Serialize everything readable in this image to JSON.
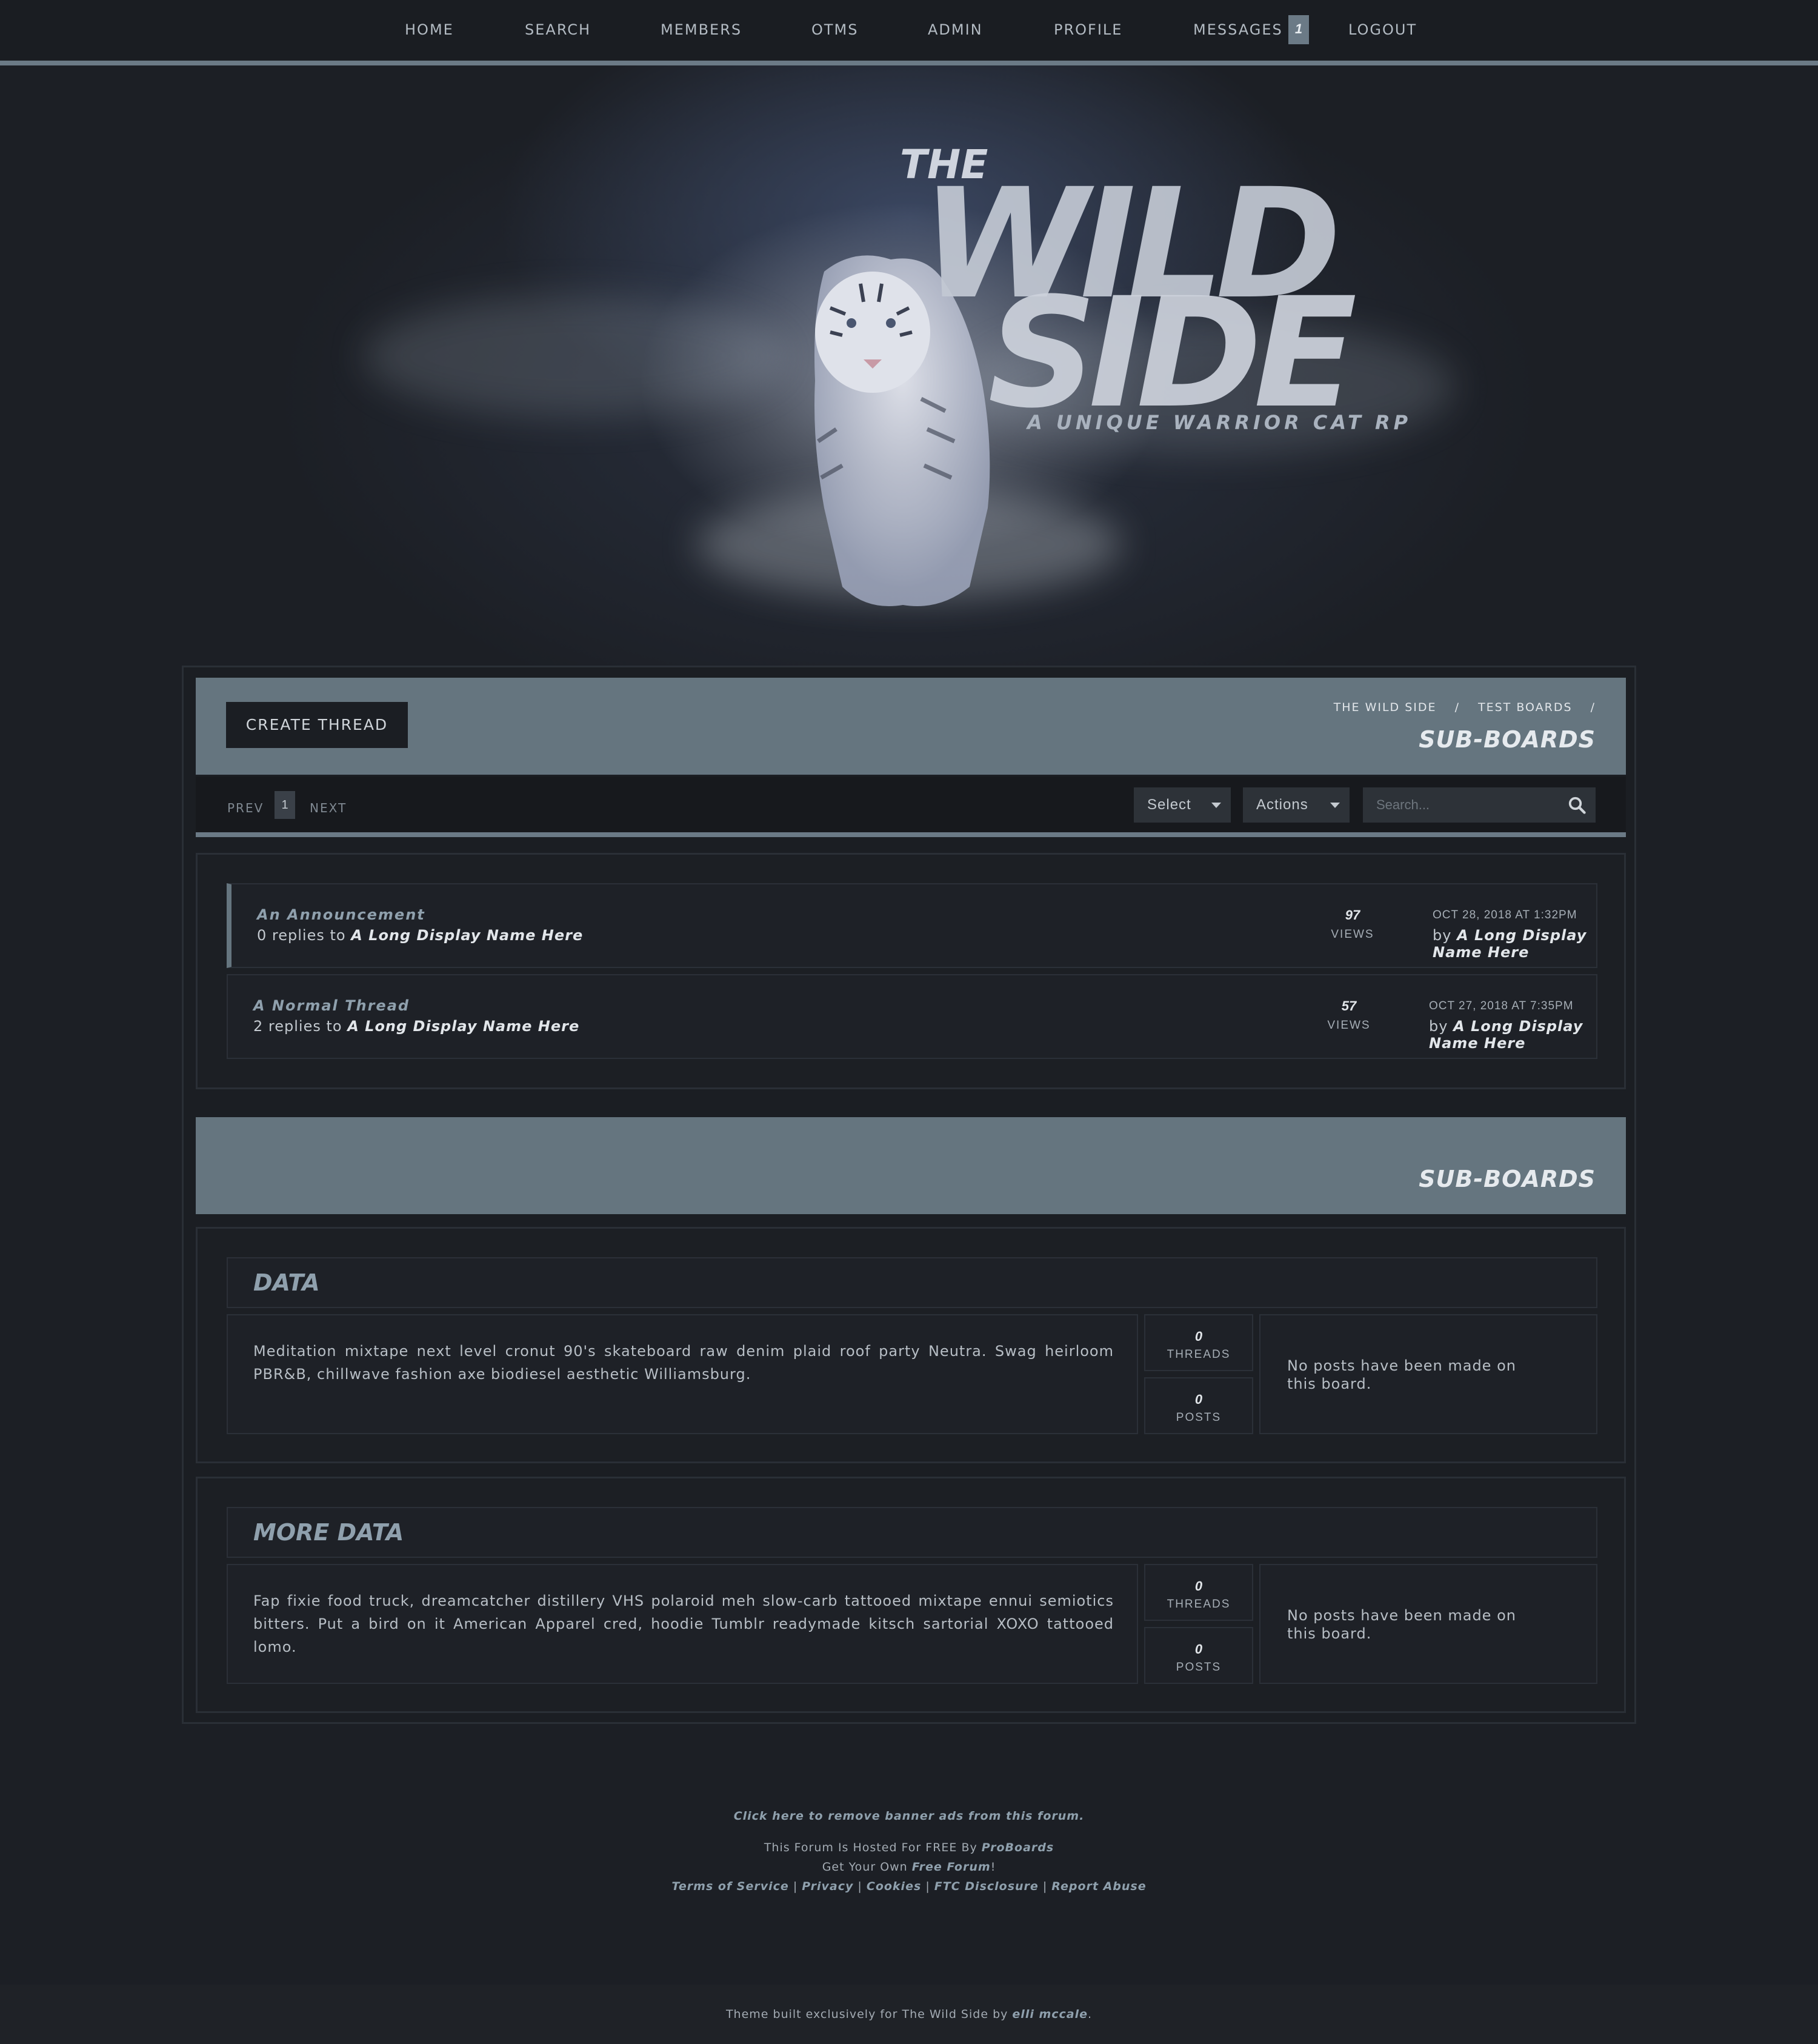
{
  "nav": {
    "items": [
      "HOME",
      "SEARCH",
      "MEMBERS",
      "OTMS",
      "ADMIN",
      "PROFILE",
      "MESSAGES",
      "LOGOUT"
    ],
    "messages_badge": "1"
  },
  "banner": {
    "the": "THE",
    "wild": "WILD",
    "side": "SIDE",
    "tagline": "A UNIQUE WARRIOR CAT RP"
  },
  "header": {
    "create_thread": "CREATE THREAD",
    "breadcrumbs": [
      "THE WILD SIDE",
      "/",
      "TEST BOARDS",
      "/"
    ],
    "title": "SUB-BOARDS"
  },
  "controls": {
    "prev": "PREV",
    "page": "1",
    "next": "NEXT",
    "select_label": "Select",
    "actions_label": "Actions",
    "search_placeholder": "Search..."
  },
  "threads": [
    {
      "title": "An Announcement",
      "replies": "0 replies to",
      "author": "A Long Display Name Here",
      "views": "97",
      "views_label": "VIEWS",
      "date": "OCT 28, 2018 AT 1:32PM",
      "by": "by",
      "last_author": "A Long Display Name Here"
    },
    {
      "title": "A Normal Thread",
      "replies": "2 replies to",
      "author": "A Long Display Name Here",
      "views": "57",
      "views_label": "VIEWS",
      "date": "OCT 27, 2018 AT 7:35PM",
      "by": "by",
      "last_author": "A Long Display Name Here"
    }
  ],
  "subboards_header": {
    "title": "SUB-BOARDS"
  },
  "boards": [
    {
      "name": "DATA",
      "description": "Meditation mixtape next level cronut 90's skateboard raw denim plaid roof party Neutra. Swag heirloom PBR&B, chillwave fashion axe biodiesel aesthetic Williamsburg.",
      "threads": "0",
      "threads_label": "THREADS",
      "posts": "0",
      "posts_label": "POSTS",
      "last_post": "No posts have been made on this board."
    },
    {
      "name": "MORE DATA",
      "description": "Fap fixie food truck, dreamcatcher distillery VHS polaroid meh slow-carb tattooed mixtape ennui semiotics bitters. Put a bird on it American Apparel cred, hoodie Tumblr readymade kitsch sartorial XOXO tattooed lomo.",
      "threads": "0",
      "threads_label": "THREADS",
      "posts": "0",
      "posts_label": "POSTS",
      "last_post": "No posts have been made on this board."
    }
  ],
  "footer": {
    "remove_ads": "Click here to remove banner ads from this forum.",
    "hosted_prefix": "This Forum Is Hosted For FREE By",
    "proboards": "ProBoards",
    "get_own_prefix": "Get Your Own",
    "free_forum": "Free Forum",
    "get_own_suffix": "!",
    "links": [
      "Terms of Service",
      "Privacy",
      "Cookies",
      "FTC Disclosure",
      "Report Abuse"
    ],
    "separator": "|",
    "credit_prefix": "Theme built exclusively for The Wild Side by",
    "credit_author": "elli mccale",
    "credit_suffix": "."
  },
  "colors": {
    "accent": "#65757f",
    "background": "#1c1f25",
    "panel": "#1e2127",
    "link": "#8fa0ad"
  }
}
